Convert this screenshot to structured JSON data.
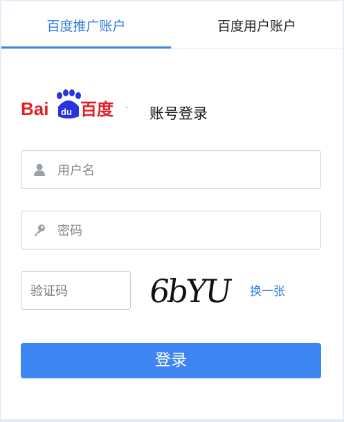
{
  "tabs": [
    {
      "label": "百度推广账户",
      "active": true
    },
    {
      "label": "百度用户账户",
      "active": false
    }
  ],
  "brand": {
    "logo_text_left": "Bai",
    "logo_paw_text": "du",
    "logo_text_right": "百度",
    "separator": "·",
    "title": "账号登录"
  },
  "form": {
    "username_placeholder": "用户名",
    "password_placeholder": "密码",
    "captcha_placeholder": "验证码",
    "captcha_image_text": "6bYU",
    "refresh_label": "换一张",
    "submit_label": "登录"
  },
  "colors": {
    "accent": "#3d86f2",
    "link": "#2f7ce0",
    "baidu_red": "#e21f26",
    "baidu_blue": "#2932e1"
  },
  "icons": {
    "username": "user-icon",
    "password": "key-icon",
    "logo_mark": "paw-icon"
  }
}
